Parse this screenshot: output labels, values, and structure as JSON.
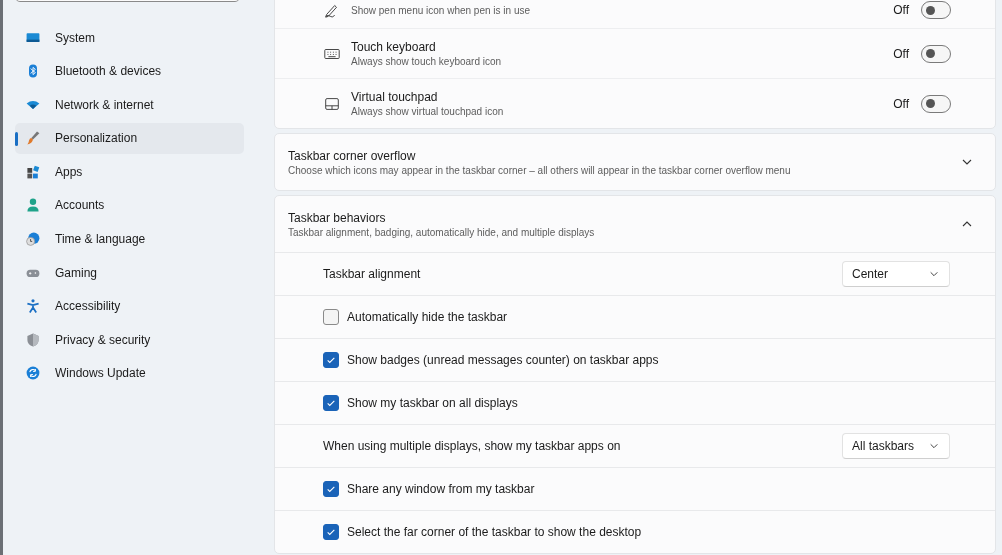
{
  "sidebar": {
    "items": [
      {
        "label": "System",
        "selected": false
      },
      {
        "label": "Bluetooth & devices",
        "selected": false
      },
      {
        "label": "Network & internet",
        "selected": false
      },
      {
        "label": "Personalization",
        "selected": true
      },
      {
        "label": "Apps",
        "selected": false
      },
      {
        "label": "Accounts",
        "selected": false
      },
      {
        "label": "Time & language",
        "selected": false
      },
      {
        "label": "Gaming",
        "selected": false
      },
      {
        "label": "Accessibility",
        "selected": false
      },
      {
        "label": "Privacy & security",
        "selected": false
      },
      {
        "label": "Windows Update",
        "selected": false
      }
    ]
  },
  "icon_rows": [
    {
      "description": "Show pen menu icon when pen is in use",
      "state_label": "Off",
      "on": false
    },
    {
      "title": "Touch keyboard",
      "description": "Always show touch keyboard icon",
      "state_label": "Off",
      "on": false
    },
    {
      "title": "Virtual touchpad",
      "description": "Always show virtual touchpad icon",
      "state_label": "Off",
      "on": false
    }
  ],
  "sections": [
    {
      "title": "Taskbar corner overflow",
      "description": "Choose which icons may appear in the taskbar corner – all others will appear in the taskbar corner overflow menu",
      "expanded": false
    },
    {
      "title": "Taskbar behaviors",
      "description": "Taskbar alignment, badging, automatically hide, and multiple displays",
      "expanded": true,
      "rows": [
        {
          "kind": "dropdown",
          "label": "Taskbar alignment",
          "value": "Center"
        },
        {
          "kind": "checkbox",
          "label": "Automatically hide the taskbar",
          "checked": false
        },
        {
          "kind": "checkbox",
          "label": "Show badges (unread messages counter) on taskbar apps",
          "checked": true
        },
        {
          "kind": "checkbox",
          "label": "Show my taskbar on all displays",
          "checked": true
        },
        {
          "kind": "dropdown",
          "label": "When using multiple displays, show my taskbar apps on",
          "value": "All taskbars"
        },
        {
          "kind": "checkbox",
          "label": "Share any window from my taskbar",
          "checked": true
        },
        {
          "kind": "checkbox",
          "label": "Select the far corner of the taskbar to show the desktop",
          "checked": true
        }
      ]
    }
  ]
}
